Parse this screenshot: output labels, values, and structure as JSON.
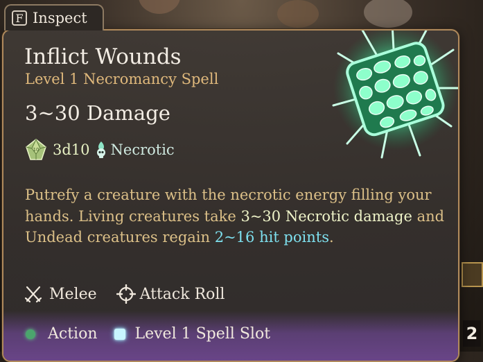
{
  "inspect_tab": {
    "key": "F",
    "label": "Inspect"
  },
  "spell": {
    "name": "Inflict Wounds",
    "subtitle": "Level 1 Necromancy Spell",
    "damage_title": "3~30 Damage",
    "dice": "3d10",
    "damage_type": "Necrotic",
    "description": {
      "part1": "Putrefy a creature with the necrotic energy filling your hands. Living creatures take ",
      "damage_value": "3~30",
      "damage_label": "Necrotic damage",
      "part2": " and Undead creatures regain ",
      "heal_value": "2~16 hit points",
      "part3": "."
    },
    "tags": [
      {
        "icon": "crossed-swords-icon",
        "label": "Melee"
      },
      {
        "icon": "crosshair-icon",
        "label": "Attack Roll"
      }
    ],
    "costs": [
      {
        "icon": "action-dot-icon",
        "label": "Action"
      },
      {
        "icon": "spell-slot-icon",
        "label": "Level 1 Spell Slot"
      }
    ]
  },
  "side_hotbar": {
    "count": "2"
  },
  "colors": {
    "border": "#b08a5c",
    "subtitle": "#e0b97c",
    "description": "#dcc088",
    "heal": "#7ee0ef",
    "necrotic_glow": "#6effc0",
    "action": "#4ba56d",
    "spell_slot": "#c8f6ff"
  }
}
